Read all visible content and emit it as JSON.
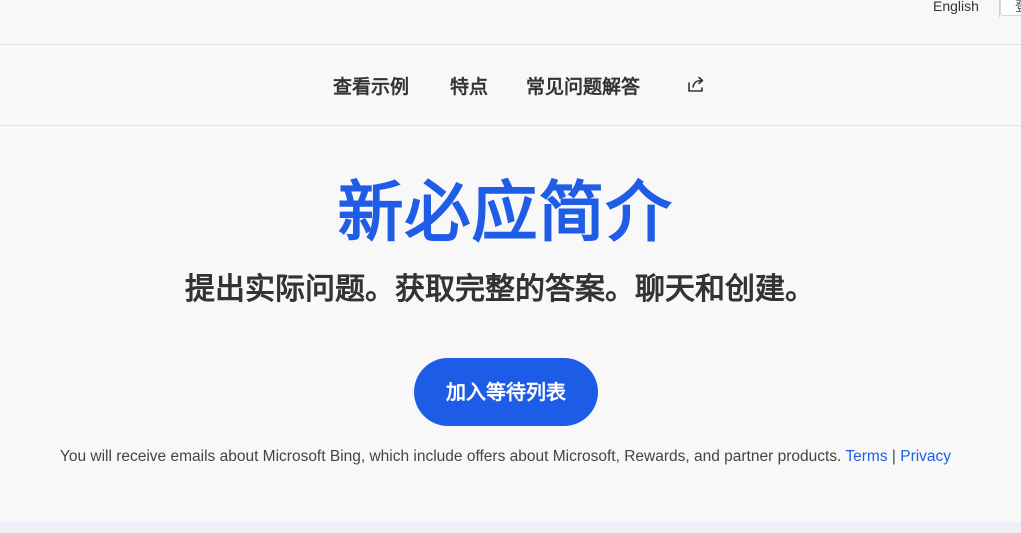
{
  "topbar": {
    "language_label": "English",
    "signin_label": "登"
  },
  "nav": {
    "examples_label": "查看示例",
    "features_label": "特点",
    "faq_label": "常见问题解答",
    "share_icon": "share-icon"
  },
  "hero": {
    "title": "新必应简介",
    "subtitle": "提出实际问题。获取完整的答案。聊天和创建。",
    "cta_label": "加入等待列表"
  },
  "disclaimer": {
    "text": "You will receive emails about Microsoft Bing, which include offers about Microsoft, Rewards, and partner products.",
    "terms_label": "Terms",
    "separator": "|",
    "privacy_label": "Privacy"
  },
  "colors": {
    "accent": "#1f5de6",
    "text": "#333333",
    "background": "#f8f8f9"
  }
}
